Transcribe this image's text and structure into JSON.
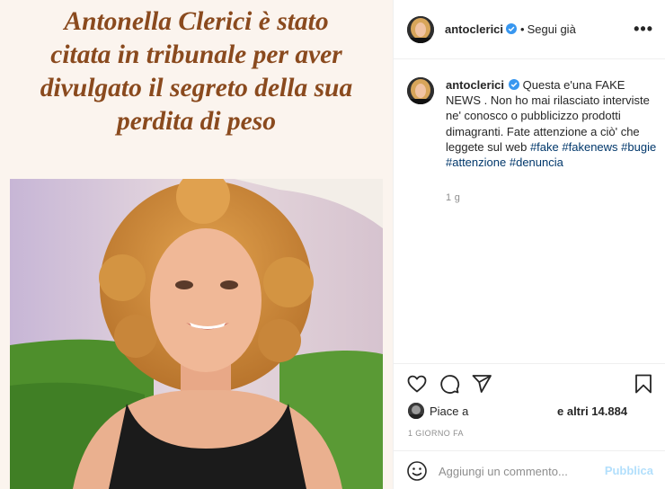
{
  "post": {
    "headline_lines": [
      "Antonella Clerici è stato",
      "citata in tribunale per aver",
      "divulgato il segreto della sua",
      "perdita di peso"
    ]
  },
  "header": {
    "username": "antoclerici",
    "separator": "•",
    "follow_label": "Segui già",
    "more_label": "•••"
  },
  "caption": {
    "username": "antoclerici",
    "text_before": "Questa e'una FAKE NEWS . Non ho mai rilasciato interviste ne' conosco o pubblicizzo prodotti dimagranti. Fate attenzione a ciò' che leggete sul web ",
    "hashtags": [
      "#fake",
      "#fakenews",
      "#bugie",
      "#attenzione",
      "#denuncia"
    ],
    "age": "1 g"
  },
  "actions": {
    "likes_prefix": "Piace a",
    "likes_count": "e altri 14.884",
    "time_ago": "1 GIORNO FA"
  },
  "comment": {
    "placeholder": "Aggiungi un commento...",
    "publish_label": "Pubblica"
  },
  "icons": {
    "like": "heart-icon",
    "comment": "comment-icon",
    "share": "send-icon",
    "save": "bookmark-icon",
    "emoji": "emoji-icon",
    "verified": "verified-badge-icon"
  },
  "colors": {
    "headline": "#8a4a1e",
    "hashtag": "#00376b",
    "verified": "#3897f0",
    "publish_disabled": "#b2dffc"
  }
}
